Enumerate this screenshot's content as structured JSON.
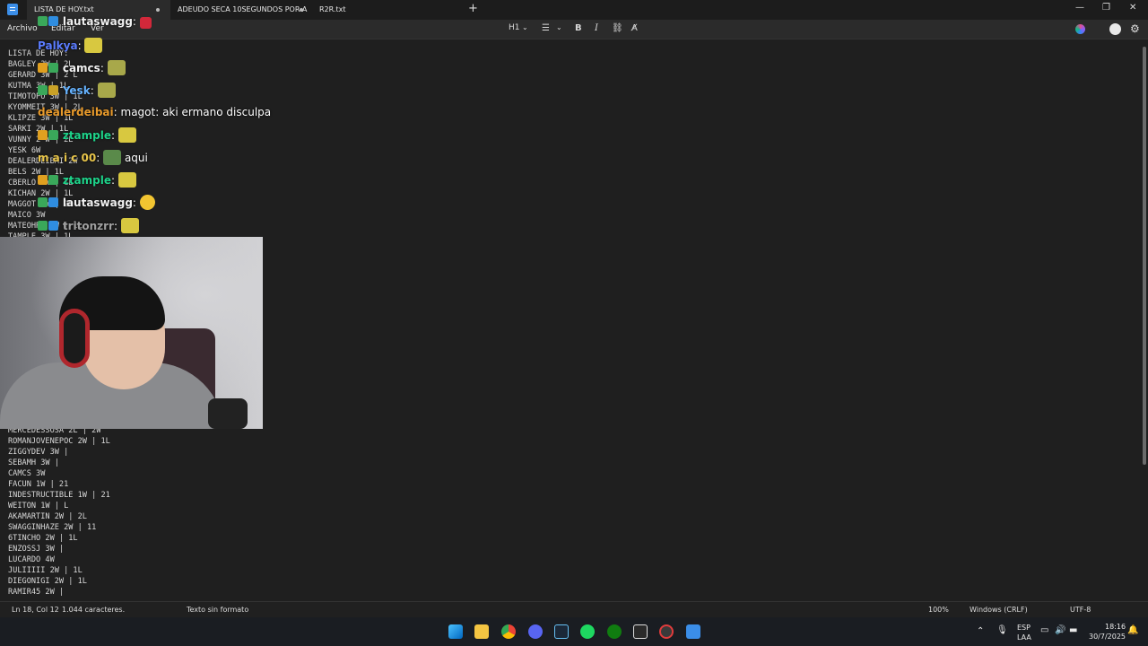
{
  "tabs": [
    {
      "label": "LISTA DE HOY.txt"
    },
    {
      "label": "ADEUDO SECA 10SEGUNDOS POR A"
    },
    {
      "label": "R2R.txt"
    }
  ],
  "menu": {
    "file": "Archivo",
    "edit": "Editar",
    "view": "Ver"
  },
  "toolbar": {
    "heading": "H1"
  },
  "editor": {
    "lines_top": [
      "LISTA DE HOY:",
      "BAGLEY 3W | 2L",
      "GERARD 3W | 2 L",
      "KUTMA 3W | 1L",
      "TIMOTOPO 3W | 1L",
      "KYOMMEIT 3W | 2L",
      "KLIPZE 3W | 1L",
      "SARKI 2W | 1L",
      "VUNNY 2 W | 2L",
      "YESK 6W",
      "DEALERDEIBAI 2W",
      "BELS 2W | 1L",
      "CBERLO 1W | 1L",
      "KICHAN 2W | 1L",
      "MAGGOT 3W | 2L",
      "MAICO 3W",
      "MATEOHRD 1W | 1L",
      "TAMPLE 3W | 1L"
    ],
    "lines_bottom": [
      "MERCEDESSOSA 2L | 2W",
      "ROMANJOVENEPOC 2W | 1L",
      "ZIGGYDEV 3W |",
      "SEBAMH 3W |",
      "CAMCS 3W",
      "FACUN 1W | 21",
      "INDESTRUCTIBLE 1W | 21",
      "WEITON 1W | L",
      "AKAMARTIN 2W | 2L",
      "SWAGGINHAZE 2W | 11",
      "6TINCHO 2W | 1L",
      "ENZOSSJ 3W |",
      "LUCARDO 4W",
      "JULIIIII 2W | 1L",
      "DIEGONIGI 2W | 1L",
      "RAMIR45 2W |"
    ]
  },
  "chat": [
    {
      "user": "lautaswagg",
      "message": "",
      "color": "#f0f0f0"
    },
    {
      "user": "Palkya",
      "message": "",
      "color": "#5b7cff"
    },
    {
      "user": "camcs",
      "message": "",
      "color": "#f0f0f0"
    },
    {
      "user": "Yesk",
      "message": "",
      "color": "#66b3ff"
    },
    {
      "user": "dealerdeibai",
      "message": "magot: aki ermano disculpa",
      "color": "#e89a2b"
    },
    {
      "user": "ztample",
      "message": "",
      "color": "#1ed38a"
    },
    {
      "user": "m a i c 00",
      "message": "aqui",
      "color": "#e8c54a"
    },
    {
      "user": "ztample",
      "message": "",
      "color": "#1ed38a"
    },
    {
      "user": "lautaswagg",
      "message": "",
      "color": "#f0f0f0"
    },
    {
      "user": "tritonzrr",
      "message": "",
      "color": "#a0a0a0"
    }
  ],
  "status": {
    "position": "Ln 18, Col 12",
    "chars": "1.044 caracteres.",
    "format": "Texto sin formato",
    "zoom": "100%",
    "eol": "Windows (CRLF)",
    "encoding": "UTF-8"
  },
  "tray": {
    "lang1": "ESP",
    "lang2": "LAA",
    "time": "18:16",
    "date": "30/7/2025"
  }
}
